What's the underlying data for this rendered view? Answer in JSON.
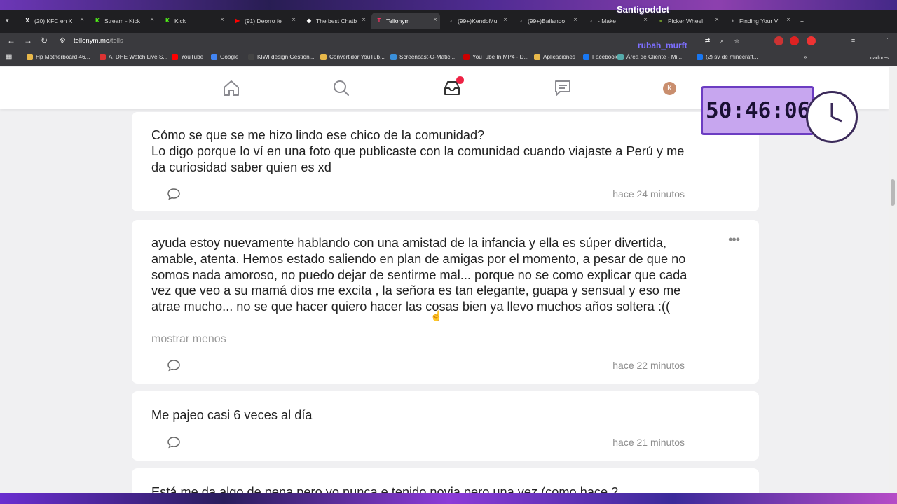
{
  "tabs": [
    {
      "label": "(20) KFC en X",
      "fav_color": "#ffffff",
      "fav_glyph": "X"
    },
    {
      "label": "Stream - Kick",
      "fav_color": "#53fc18",
      "fav_glyph": "K"
    },
    {
      "label": "Kick",
      "fav_color": "#53fc18",
      "fav_glyph": "K"
    },
    {
      "label": "(91) Deorro fe",
      "fav_color": "#ff0000",
      "fav_glyph": "▶"
    },
    {
      "label": "The best Chatb",
      "fav_color": "#ffffff",
      "fav_glyph": "◆"
    },
    {
      "label": "Tellonym",
      "fav_color": "#ff3366",
      "fav_glyph": "T"
    },
    {
      "label": "(99+)KendoMu",
      "fav_color": "#ffffff",
      "fav_glyph": "♪"
    },
    {
      "label": "(99+)Bailando",
      "fav_color": "#ffffff",
      "fav_glyph": "♪"
    },
    {
      "label": "- Make",
      "fav_color": "#ffffff",
      "fav_glyph": "♪"
    },
    {
      "label": "Picker Wheel",
      "fav_color": "#6a8f2b",
      "fav_glyph": "●"
    },
    {
      "label": "Finding Your V",
      "fav_color": "#ffffff",
      "fav_glyph": "♪"
    }
  ],
  "url": {
    "domain": "tellonym.me",
    "path": "/tells"
  },
  "bookmarks": [
    {
      "label": "Hp Motherboard 46...",
      "color": "#e8b84a"
    },
    {
      "label": "ATDHE Watch Live S...",
      "color": "#d33"
    },
    {
      "label": "YouTube",
      "color": "#ff0000"
    },
    {
      "label": "Google",
      "color": "#4285f4"
    },
    {
      "label": "KIWI design Gestión...",
      "color": "#444"
    },
    {
      "label": "Convertidor YouTub...",
      "color": "#e8b84a"
    },
    {
      "label": "Screencast-O-Matic...",
      "color": "#3a8fd9"
    },
    {
      "label": "YouTube In MP4 - D...",
      "color": "#c00"
    },
    {
      "label": "Aplicaciones",
      "color": "#e8b84a"
    },
    {
      "label": "Facebook",
      "color": "#1877f2"
    },
    {
      "label": "Área de Cliente - Mi...",
      "color": "#5aa"
    },
    {
      "label": "(2) sv de minecraft...",
      "color": "#1877f2"
    }
  ],
  "bookmarks_overflow": "»",
  "bookmarks_other": "cadores",
  "app": {
    "avatar_letter": "K"
  },
  "cards": [
    {
      "text": "Cómo se que se me hizo lindo ese chico de la comunidad?\nLo digo porque lo ví en una foto que publicaste con la comunidad cuando viajaste a Perú y me da curiosidad saber quien es xd",
      "time": "hace 24 minutos"
    },
    {
      "text": "ayuda estoy nuevamente hablando con una amistad de la infancia y ella es súper divertida, amable, atenta. Hemos estado saliendo en plan de amigas por el momento, a pesar de que no somos nada amoroso, no puedo dejar de sentirme mal... porque no se como explicar que cada vez que veo a su mamá dios me excita , la señora es tan elegante, guapa y sensual y eso me atrae mucho... no se que hacer quiero hacer las cosas bien ya llevo muchos años soltera :((",
      "toggle": "mostrar menos",
      "time": "hace 22 minutos",
      "more": "•••"
    },
    {
      "text": "Me pajeo casi 6 veces al día",
      "time": "hace 21 minutos"
    },
    {
      "text": "Está me da algo de pena pero yo nunca e tenido novia pero una vez (como hace 2"
    }
  ],
  "overlay": {
    "timer": "50:46:06",
    "streamer": "Santigoddet",
    "chatter": "rubah_murft"
  }
}
